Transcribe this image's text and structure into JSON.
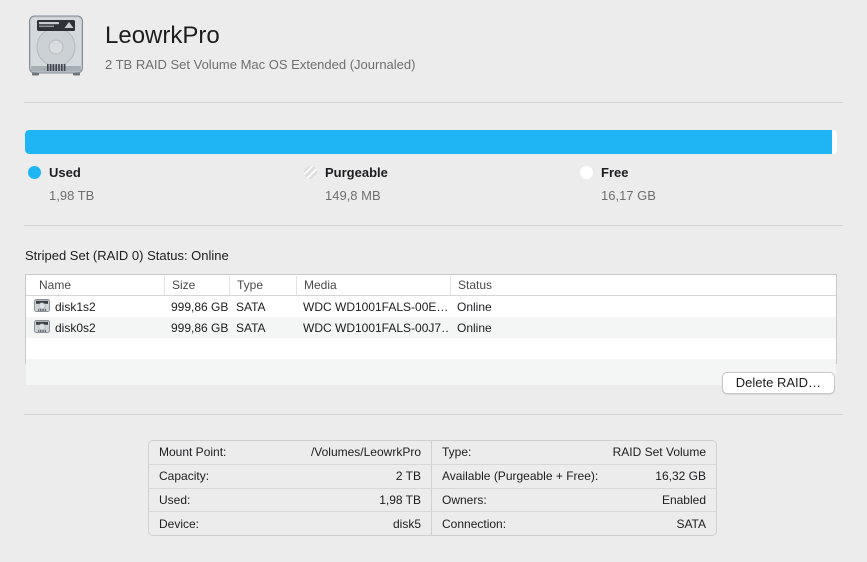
{
  "header": {
    "title": "LeowrkPro",
    "subtitle": "2 TB RAID Set Volume Mac OS Extended (Journaled)"
  },
  "usage": {
    "bar": {
      "used_pct": 99.4,
      "used_color": "#1fb5f4",
      "free_color": "#ffffff"
    },
    "legend": [
      {
        "label": "Used",
        "value": "1,98 TB",
        "swatch": "solid-blue"
      },
      {
        "label": "Purgeable",
        "value": "149,8 MB",
        "swatch": "striped-gray"
      },
      {
        "label": "Free",
        "value": "16,17 GB",
        "swatch": "white"
      }
    ]
  },
  "raid": {
    "status_line": "Striped Set (RAID 0) Status: Online",
    "table": {
      "columns": [
        "Name",
        "Size",
        "Type",
        "Media",
        "Status"
      ],
      "rows": [
        {
          "name": "disk1s2",
          "size": "999,86 GB",
          "type": "SATA",
          "media": "WDC WD1001FALS-00E…",
          "status": "Online"
        },
        {
          "name": "disk0s2",
          "size": "999,86 GB",
          "type": "SATA",
          "media": "WDC WD1001FALS-00J7…",
          "status": "Online"
        }
      ]
    },
    "delete_button": "Delete RAID…"
  },
  "info": {
    "left": [
      {
        "label": "Mount Point:",
        "value": "/Volumes/LeowrkPro"
      },
      {
        "label": "Capacity:",
        "value": "2 TB"
      },
      {
        "label": "Used:",
        "value": "1,98 TB"
      },
      {
        "label": "Device:",
        "value": "disk5"
      }
    ],
    "right": [
      {
        "label": "Type:",
        "value": "RAID Set Volume"
      },
      {
        "label": "Available (Purgeable + Free):",
        "value": "16,32 GB"
      },
      {
        "label": "Owners:",
        "value": "Enabled"
      },
      {
        "label": "Connection:",
        "value": "SATA"
      }
    ]
  }
}
